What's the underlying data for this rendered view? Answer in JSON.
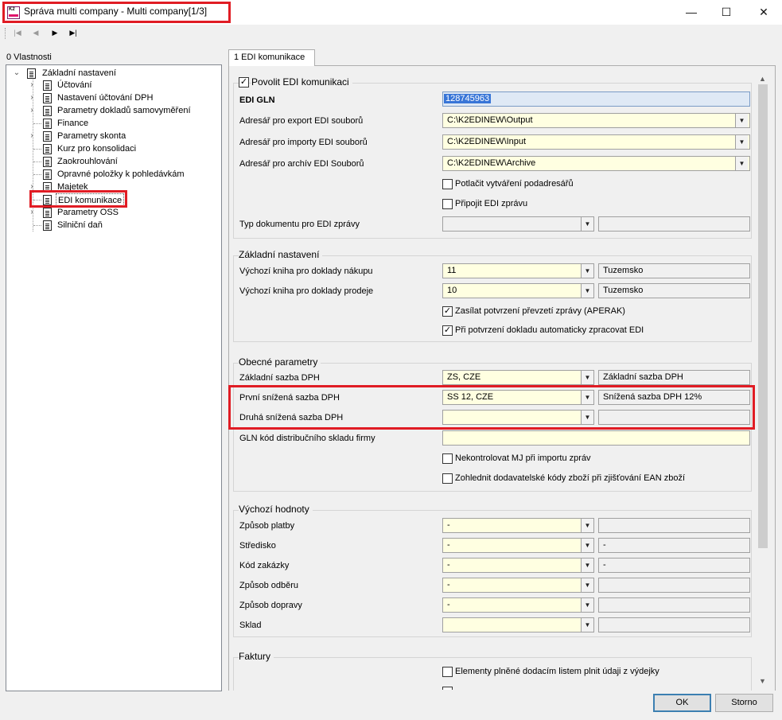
{
  "window": {
    "title": "Správa multi company - Multi company[1/3]",
    "app_icon_text": "K2",
    "minimize": "—",
    "maximize": "☐",
    "close": "✕"
  },
  "nav": {
    "first": "|◀",
    "prev": "◀",
    "next": "▶",
    "last": "▶|"
  },
  "tree": {
    "header": "0 Vlastnosti",
    "root": "Základní nastavení",
    "items": [
      "Účtování",
      "Nastavení účtování DPH",
      "Parametry dokladů samovyměření",
      "Finance",
      "Parametry skonta",
      "Kurz pro konsolidaci",
      "Zaokrouhlování",
      "Opravné položky k pohledávkám",
      "Majetek",
      "EDI komunikace",
      "Parametry OSS",
      "Silniční daň"
    ]
  },
  "tab": {
    "label": "1 EDI komunikace"
  },
  "edi": {
    "enable_label": "Povolit EDI komunikaci",
    "gln_label": "EDI GLN",
    "gln_value": "128745963",
    "export_label": "Adresář pro export EDI souborů",
    "export_value": "C:\\K2EDINEW\\Output",
    "import_label": "Adresář pro importy EDI souborů",
    "import_value": "C:\\K2EDINEW\\Input",
    "archive_label": "Adresář pro archív EDI Souborů",
    "archive_value": "C:\\K2EDINEW\\Archive",
    "suppress_label": "Potlačit vytváření podadresářů",
    "attach_label": "Připojit EDI zprávu",
    "doctype_label": "Typ dokumentu pro EDI zprávy",
    "doctype_value": "",
    "doctype_desc": ""
  },
  "basic": {
    "title": "Základní nastavení",
    "purchase_label": "Výchozí kniha pro doklady nákupu",
    "purchase_value": "11",
    "purchase_desc": "Tuzemsko",
    "sales_label": "Výchozí kniha pro doklady prodeje",
    "sales_value": "10",
    "sales_desc": "Tuzemsko",
    "confirm_label": "Zasílat potvrzení převzetí zprávy (APERAK)",
    "auto_label": "Při potvrzení dokladu automaticky zpracovat EDI"
  },
  "general": {
    "title": "Obecné parametry",
    "base_vat_label": "Základní sazba DPH",
    "base_vat_value": "ZS, CZE",
    "base_vat_desc": "Základní sazba DPH",
    "first_vat_label": "První snížená sazba DPH",
    "first_vat_value": "SS 12, CZE",
    "first_vat_desc": "Snížená sazba DPH 12%",
    "second_vat_label": "Druhá snížená sazba DPH",
    "second_vat_value": "",
    "second_vat_desc": "",
    "gln_warehouse_label": "GLN kód distribučního skladu firmy",
    "gln_warehouse_value": "",
    "nocheck_label": "Nekontrolovat MJ při importu zpráv",
    "supplier_codes_label": "Zohlednit dodavatelské kódy zboží při zjišťování EAN zboží"
  },
  "defaults": {
    "title": "Výchozí hodnoty",
    "rows": [
      {
        "label": "Způsob platby",
        "value": "-",
        "desc": ""
      },
      {
        "label": "Středisko",
        "value": "-",
        "desc": "-"
      },
      {
        "label": "Kód zakázky",
        "value": "-",
        "desc": "-"
      },
      {
        "label": "Způsob odběru",
        "value": "-",
        "desc": ""
      },
      {
        "label": "Způsob dopravy",
        "value": "-",
        "desc": ""
      },
      {
        "label": "Sklad",
        "value": "",
        "desc": ""
      }
    ]
  },
  "invoices": {
    "title": "Faktury",
    "delivery_label": "Elementy plněné dodacím listem plnit údaji z výdejky"
  },
  "buttons": {
    "ok": "OK",
    "cancel": "Storno"
  },
  "colors": {
    "highlight_red": "#e01c24",
    "required_yellow": "#ffffe1",
    "selection_blue": "#3875d7"
  },
  "checkbox_state": {
    "enable": true,
    "suppress": false,
    "attach": false,
    "confirm": true,
    "auto": true,
    "nocheck": false,
    "supplier_codes": false,
    "delivery": false
  },
  "icons": {
    "checked": "✓",
    "dropdown": "▼",
    "expand": "›",
    "collapse": "⌄",
    "scroll_up": "▲",
    "scroll_down": "▼"
  }
}
